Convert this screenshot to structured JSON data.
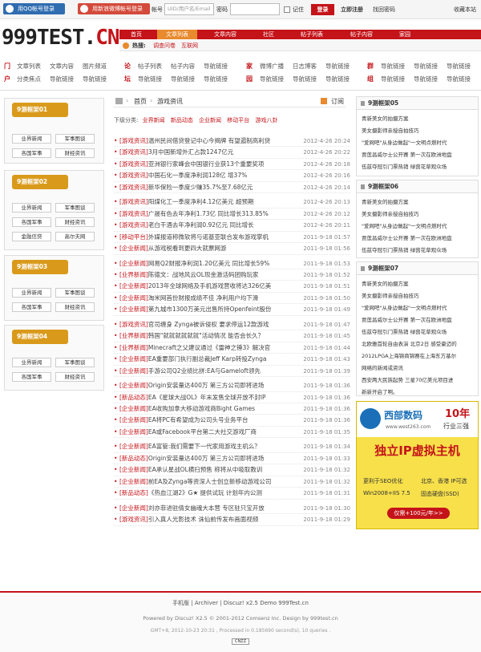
{
  "topbar": {
    "qq_login": "用QQ帐号登录",
    "weibo_login": "用新浪微博帐号登录",
    "account_label": "帐号",
    "account_placeholder": "UID/用户名/Email",
    "password_label": "密码",
    "remember": "记住",
    "login": "登录",
    "register": "立即注册",
    "forgot": "找回密码",
    "favorite": "收藏本站"
  },
  "logo": {
    "main": "999TEST.",
    "suffix": "CN"
  },
  "nav": {
    "items": [
      "首页",
      "文章列表",
      "文章内容",
      "社区",
      "帖子列表",
      "帖子内容",
      "家园"
    ],
    "hot_label": "热搜:",
    "hot_items": [
      "调查问卷",
      "互联网"
    ]
  },
  "link_groups": [
    {
      "title": "门户",
      "links": [
        "文章列表",
        "文章内容",
        "图片频道",
        "分类焦点",
        "导航链接",
        "导航链接"
      ]
    },
    {
      "title": "论坛",
      "links": [
        "帖子列表",
        "帖子内容",
        "导航链接",
        "导航链接",
        "导航链接",
        "导航链接"
      ]
    },
    {
      "title": "家园",
      "links": [
        "微博广播",
        "日志博客",
        "导航链接",
        "导航链接",
        "导航链接",
        "导航链接"
      ]
    },
    {
      "title": "群组",
      "links": [
        "导航链接",
        "导航链接",
        "导航链接",
        "导航链接",
        "导航链接",
        "导航链接"
      ]
    }
  ],
  "sidebar": [
    {
      "title": "9测框架01",
      "buttons": [
        "业界新闻",
        "军事图谈",
        "各国军事",
        "财经资讯"
      ]
    },
    {
      "title": "9测框架02",
      "buttons": [
        "业界新闻",
        "军事图谈",
        "各国军事",
        "财经资讯",
        "金融信贷",
        "高尔夫网"
      ]
    },
    {
      "title": "9测框架03",
      "buttons": [
        "业界新闻",
        "军事图谈",
        "各国军事",
        "财经资讯"
      ]
    },
    {
      "title": "9测框架04",
      "buttons": [
        "业界新闻",
        "军事图谈",
        "各国军事",
        "财经资讯"
      ]
    }
  ],
  "breadcrumb": {
    "home": "首页",
    "sep": "›",
    "current": "游戏资讯",
    "subscribe": "订阅"
  },
  "subcategories": {
    "label": "下级分类:",
    "items": [
      "业界新闻",
      "新品动态",
      "企业新闻",
      "移动平台",
      "游戏八卦"
    ]
  },
  "news": [
    {
      "cat": "[游戏资讯]",
      "title": "温州民间借贷登记中心今揭牌 有望遏制高利贷",
      "time": "2012-4-26 20:24"
    },
    {
      "cat": "[游戏资讯]",
      "title": "3月中国新增外汇占款1247亿元",
      "time": "2012-4-26 20:22"
    },
    {
      "cat": "[游戏资讯]",
      "title": "亚洲银行家峰会中国银行业获13个重要奖项",
      "time": "2012-4-26 20:18"
    },
    {
      "cat": "[游戏资讯]",
      "title": "中国石化一季度净利润128亿 增37%",
      "time": "2012-4-26 20:16"
    },
    {
      "cat": "[游戏资讯]",
      "title": "新华保险一季度少赚35.7%至7.68亿元",
      "time": "2012-4-26 20:14"
    },
    {
      "cat": "[游戏资讯]",
      "title": "阳煤化工一季度净利4.12亿美元 超预期",
      "time": "2012-4-26 20:13"
    },
    {
      "cat": "[游戏资讯]",
      "title": "广晟有色去年净利1.73亿 同比增长313.85%",
      "time": "2012-4-26 20:12"
    },
    {
      "cat": "[游戏资讯]",
      "title": "老白干酒去年净利润0.92亿元 同比增长",
      "time": "2012-4-26 20:11"
    },
    {
      "cat": "[移动平台]",
      "title": "外媒报道称微软将与诺基亚联合发布游戏掌机",
      "time": "2011-9-18 01:57"
    },
    {
      "cat": "[企业新闻]",
      "title": "从游戏税看到更四大就票网游",
      "time": "2011-9-18 01:56"
    },
    {
      "cat": "[企业新闻]",
      "title": "网易Q2财报净利润1.20亿美元 同比增长59%",
      "time": "2011-9-18 01:53"
    },
    {
      "cat": "[业界新闻]",
      "title": "陈德文：战地风云OL现金激活码团购玩家",
      "time": "2011-9-18 01:52"
    },
    {
      "cat": "[企业新闻]",
      "title": "2013年全球网络及手机游戏营收将达326亿美",
      "time": "2011-9-18 01:51"
    },
    {
      "cat": "[企业新闻]",
      "title": "淘米网首份财报成绩不佳 净利用户均下滑",
      "time": "2011-9-18 01:50"
    },
    {
      "cat": "[企业新闻]",
      "title": "第九城市1300万美元出售所持Openfeint股份",
      "time": "2011-9-18 01:49"
    },
    {
      "cat": "[游戏资讯]",
      "title": "官司缠身 Zynga被诉侵权 要求停运12款游戏",
      "time": "2011-9-18 01:47"
    },
    {
      "cat": "[业界新闻]",
      "title": "韩国\"就就就就就就\"活动情况 能否会长久？",
      "time": "2011-9-18 01:45"
    },
    {
      "cat": "[业界新闻]",
      "title": "Minecraft之父建议通过《雷神之锤3》解决官",
      "time": "2011-9-18 01:44"
    },
    {
      "cat": "[企业新闻]",
      "title": "EA重要部门执行副总裁Jeff Karp转投Zynga",
      "time": "2011-9-18 01:43"
    },
    {
      "cat": "[企业新闻]",
      "title": "手游公司Q2业绩比拼:EA与Gameloft领先",
      "time": "2011-9-18 01:39"
    },
    {
      "cat": "[企业新闻]",
      "title": "Origin安装量达400万 第三方公司即将进场",
      "time": "2011-9-18 01:36"
    },
    {
      "cat": "[新品动态]",
      "title": "EA《星球大战OL》年末发售全球开放不封IP",
      "time": "2011-9-18 01:36"
    },
    {
      "cat": "[企业新闻]",
      "title": "EA收购加拿大移动游戏商Bight Games",
      "time": "2011-9-18 01:36"
    },
    {
      "cat": "[企业新闻]",
      "title": "EA将PC有希望成为公司头号业务平台",
      "time": "2011-9-18 01:36"
    },
    {
      "cat": "[企业新闻]",
      "title": "EA或Facebook平台第二大社交游戏厂商",
      "time": "2011-9-18 01:35"
    },
    {
      "cat": "[企业新闻]",
      "title": "EA富管:我们需要下一代家用游戏主机么？",
      "time": "2011-9-18 01:34"
    },
    {
      "cat": "[新品动态]",
      "title": "Origin安装量达400万 第三方公司即将进场",
      "time": "2011-9-18 01:33"
    },
    {
      "cat": "[企业新闻]",
      "title": "EA承认星战OL横扫预售 称将从中吸取教训",
      "time": "2011-9-18 01:32"
    },
    {
      "cat": "[企业新闻]",
      "title": "前EA及Zynga等资深人士创立新移动游戏公司",
      "time": "2011-9-18 01:32"
    },
    {
      "cat": "[新品动态]",
      "title": "《热血江湖2》G★ 提供试玩 计划年内公测",
      "time": "2011-9-18 01:31"
    },
    {
      "cat": "[企业新闻]",
      "title": "刘亦菲进驻倩女幽魂大本营 专区驻只宝开放",
      "time": "2011-9-18 01:30"
    },
    {
      "cat": "[游戏资讯]",
      "title": "引入真人光影技术 诛仙前传发布画面视频",
      "time": "2011-9-18 01:29"
    }
  ],
  "right_boxes": [
    {
      "title": "9测框架05",
      "items": [
        "青新美女的拍摄方案",
        "美女摄影师亲授自拍技巧",
        "\"爱网吧\"从身边做起\"一文明点燃时代",
        "贾莲昌威尔士公开赛 第一次在欧洲地盘",
        "伍兹夺冠引门票热销 绿茵花草观众场"
      ]
    },
    {
      "title": "9测框架06",
      "items": [
        "青新美女的拍摄方案",
        "美女摄影师亲授自拍技巧",
        "\"爱网吧\"从身边做起\"一文明点燃时代",
        "贾莲昌威尔士公开赛 第一次在欧洲地盘",
        "伍兹夺冠引门票热销 绿茵花草观众场"
      ]
    },
    {
      "title": "9测框架07",
      "items": [
        "青新美女的拍摄方案",
        "美女摄影师亲授自拍技巧",
        "\"爱网吧\"从身边做起\"一文明点燃时代",
        "贾莲昌威尔士公开赛 第一次在欧洲地盘",
        "伍兹夺冠引门票热销 绿茵花草观众场",
        "北欧雅首轮自由表演 北京2日 感受豪迈的",
        "2012LPGA上海锦商锦赛在上海东方基尔",
        "网络的新闻或资讯",
        "西安两大民族起势 三星70亿美元项目进",
        "新新开启了啊。"
      ]
    }
  ],
  "ad": {
    "brand": "西部数码",
    "url": "www.west263.com",
    "years": "10年",
    "tag": "行业三强",
    "headline": "独立IP虚拟主机",
    "features": [
      "更利于SEO优化",
      "北京、香港 IP可选",
      "Win2008+IIS 7.5",
      "固态硬盘(SSD)"
    ],
    "price": "仅需+100元/年>>"
  },
  "footer": {
    "links": [
      "手机版",
      "Archiver",
      "Discuz! x2.5 Demo 999Test.cn"
    ],
    "powered": "Powered by Discuz! X2.5 © 2001-2012 Comsenz Inc. Design by 999test.cn",
    "gmt": "GMT+8, 2012-10-23 20:31 , Processed in 0.185690 second(s), 10 queries .",
    "badge": "CNZZ"
  },
  "colors": {
    "brand_red": "#c4141a",
    "orange": "#e88a2d",
    "side_gold": "#d99a1c"
  }
}
